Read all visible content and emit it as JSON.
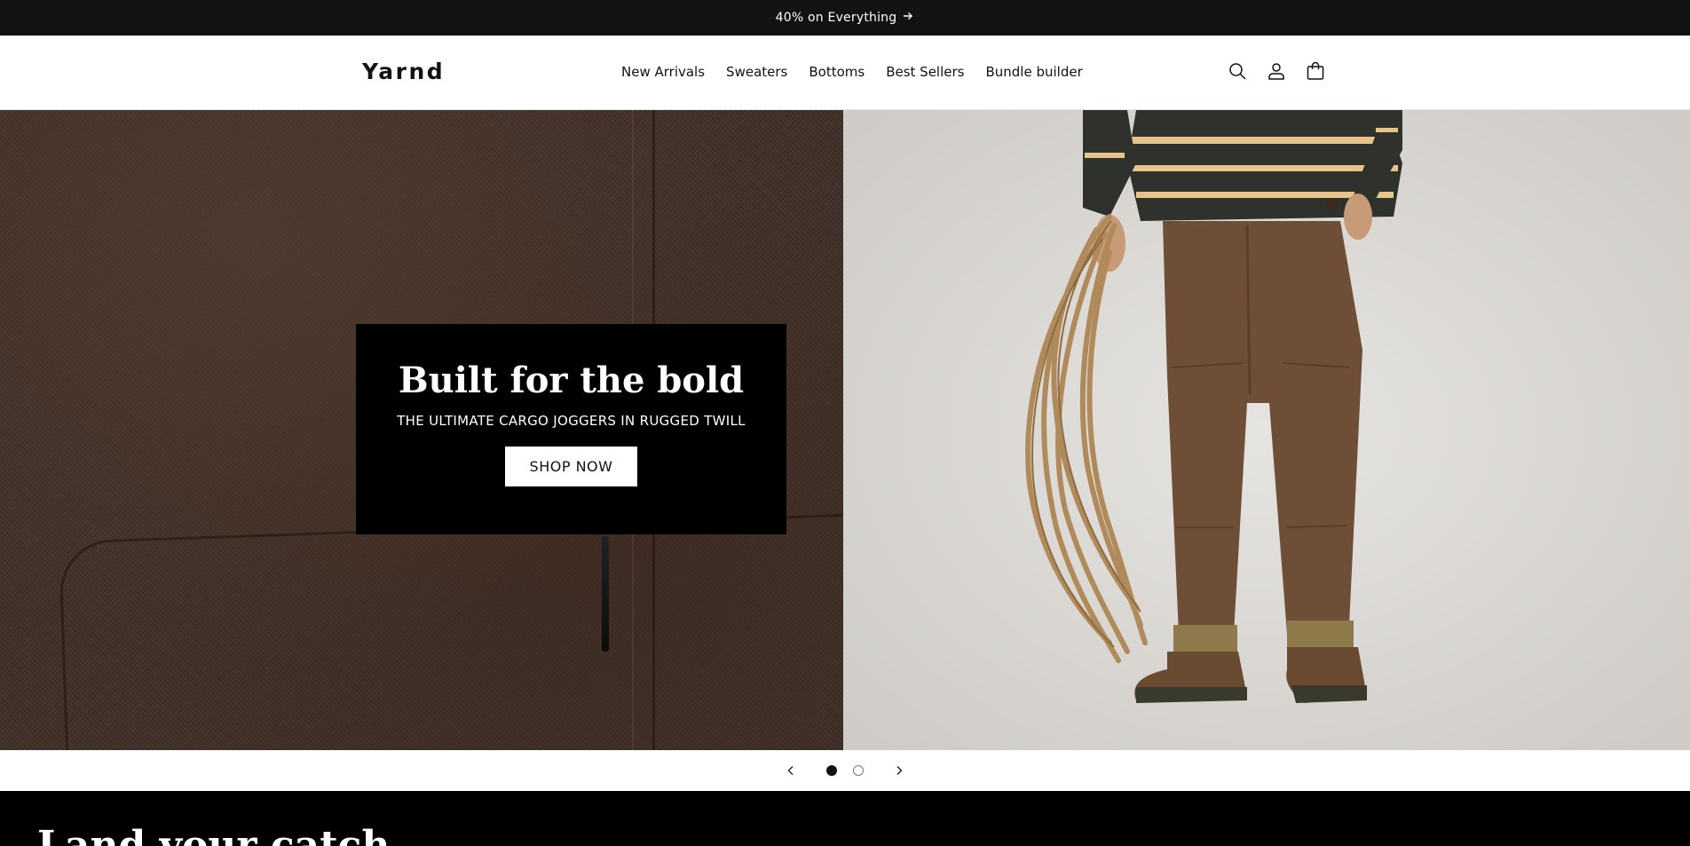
{
  "announcement": {
    "text": "40% on Everything",
    "arrow_icon": "arrow-right-icon"
  },
  "header": {
    "logo": "Yarnd",
    "nav": [
      {
        "label": "New Arrivals"
      },
      {
        "label": "Sweaters"
      },
      {
        "label": "Bottoms"
      },
      {
        "label": "Best Sellers"
      },
      {
        "label": "Bundle builder"
      }
    ],
    "icons": [
      "search-icon",
      "account-icon",
      "cart-icon"
    ]
  },
  "hero": {
    "title": "Built for the bold",
    "subtitle": "THE ULTIMATE CARGO JOGGERS IN RUGGED TWILL",
    "button": "SHOP NOW"
  },
  "slider": {
    "total_slides": 2,
    "current_slide": 1,
    "prev_icon": "chevron-left-icon",
    "next_icon": "chevron-right-icon"
  },
  "next_section": {
    "heading": "Land your catch"
  },
  "colors": {
    "announcement_bg": "#121212",
    "hero_box_bg": "#000000",
    "text": "#121212",
    "section_bg": "#000000"
  }
}
